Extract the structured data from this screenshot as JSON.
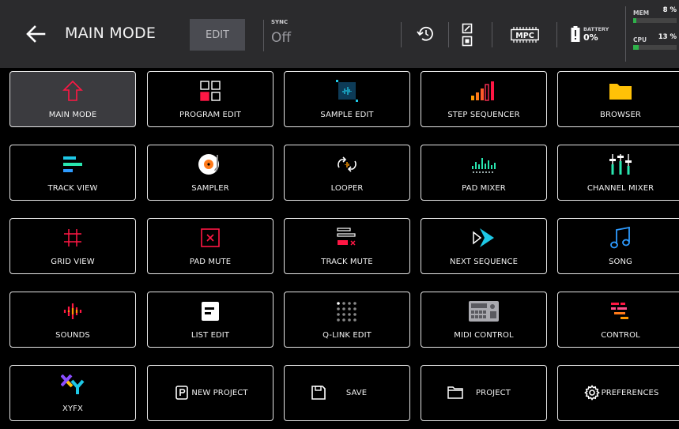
{
  "header": {
    "title": "MAIN MODE",
    "edit_label": "EDIT",
    "sync_label": "SYNC",
    "sync_value": "Off",
    "battery_label": "BATTERY",
    "battery_value": "0%",
    "mem_label": "MEM",
    "mem_value": "8 %",
    "mem_fraction": 0.08,
    "cpu_label": "CPU",
    "cpu_value": "13 %",
    "cpu_fraction": 0.13,
    "icons": [
      "back-arrow-icon",
      "undo-history-icon",
      "mode-toggle-icon",
      "mpc-logo-icon",
      "battery-icon"
    ],
    "mpc_logo_text": "MPC"
  },
  "tiles": [
    {
      "label": "MAIN MODE",
      "icon": "house-outline-icon",
      "active": true
    },
    {
      "label": "PROGRAM EDIT",
      "icon": "program-grid-icon"
    },
    {
      "label": "SAMPLE EDIT",
      "icon": "sample-wave-icon"
    },
    {
      "label": "STEP SEQUENCER",
      "icon": "step-bars-icon"
    },
    {
      "label": "BROWSER",
      "icon": "folder-icon"
    },
    {
      "label": "TRACK VIEW",
      "icon": "track-lines-icon"
    },
    {
      "label": "SAMPLER",
      "icon": "vinyl-icon"
    },
    {
      "label": "LOOPER",
      "icon": "loop-arrows-icon"
    },
    {
      "label": "PAD MIXER",
      "icon": "pad-mixer-icon"
    },
    {
      "label": "CHANNEL MIXER",
      "icon": "faders-icon"
    },
    {
      "label": "GRID VIEW",
      "icon": "hash-grid-icon"
    },
    {
      "label": "PAD MUTE",
      "icon": "pad-mute-icon"
    },
    {
      "label": "TRACK MUTE",
      "icon": "track-mute-icon"
    },
    {
      "label": "NEXT SEQUENCE",
      "icon": "next-sequence-icon"
    },
    {
      "label": "SONG",
      "icon": "music-note-icon"
    },
    {
      "label": "SOUNDS",
      "icon": "sounds-icon"
    },
    {
      "label": "LIST EDIT",
      "icon": "list-doc-icon"
    },
    {
      "label": "Q-LINK EDIT",
      "icon": "dot-matrix-icon"
    },
    {
      "label": "MIDI CONTROL",
      "icon": "midi-device-icon"
    },
    {
      "label": "CONTROL",
      "icon": "control-bars-icon"
    },
    {
      "label": "XYFX",
      "icon": "xy-icon"
    },
    {
      "label": "NEW PROJECT",
      "icon": "new-project-icon",
      "inline": true
    },
    {
      "label": "SAVE",
      "icon": "save-icon",
      "inline": true
    },
    {
      "label": "PROJECT",
      "icon": "project-folder-icon",
      "inline": true
    },
    {
      "label": "PREFERENCES",
      "icon": "gear-icon",
      "inline": true
    }
  ],
  "colors": {
    "header_bg": "#2b2b2d",
    "active_tile_bg": "#3b3b3f",
    "accent_red": "#ff1744",
    "accent_cyan": "#1ec8e6",
    "accent_orange": "#ff9800",
    "accent_yellow": "#ffc107",
    "accent_green": "#2eb24a"
  }
}
